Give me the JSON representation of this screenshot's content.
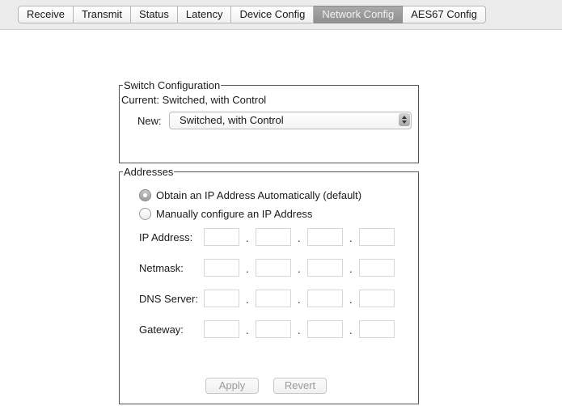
{
  "tabs": [
    {
      "label": "Receive"
    },
    {
      "label": "Transmit"
    },
    {
      "label": "Status"
    },
    {
      "label": "Latency"
    },
    {
      "label": "Device Config"
    },
    {
      "label": "Network Config",
      "active": true
    },
    {
      "label": "AES67 Config"
    }
  ],
  "switch_config": {
    "title": "Switch Configuration",
    "current": "Current: Switched, with Control",
    "new_label": "New:",
    "selected": "Switched, with Control"
  },
  "addresses": {
    "title": "Addresses",
    "auto_option": "Obtain an IP Address Automatically (default)",
    "manual_option": "Manually configure an IP Address",
    "selected_option": "auto",
    "fields": [
      {
        "label": "IP Address:",
        "octets": [
          "",
          "",
          "",
          ""
        ]
      },
      {
        "label": "Netmask:",
        "octets": [
          "",
          "",
          "",
          ""
        ]
      },
      {
        "label": "DNS Server:",
        "octets": [
          "",
          "",
          "",
          ""
        ]
      },
      {
        "label": "Gateway:",
        "octets": [
          "",
          "",
          "",
          ""
        ]
      }
    ],
    "separator": ".",
    "apply_label": "Apply",
    "revert_label": "Revert"
  }
}
